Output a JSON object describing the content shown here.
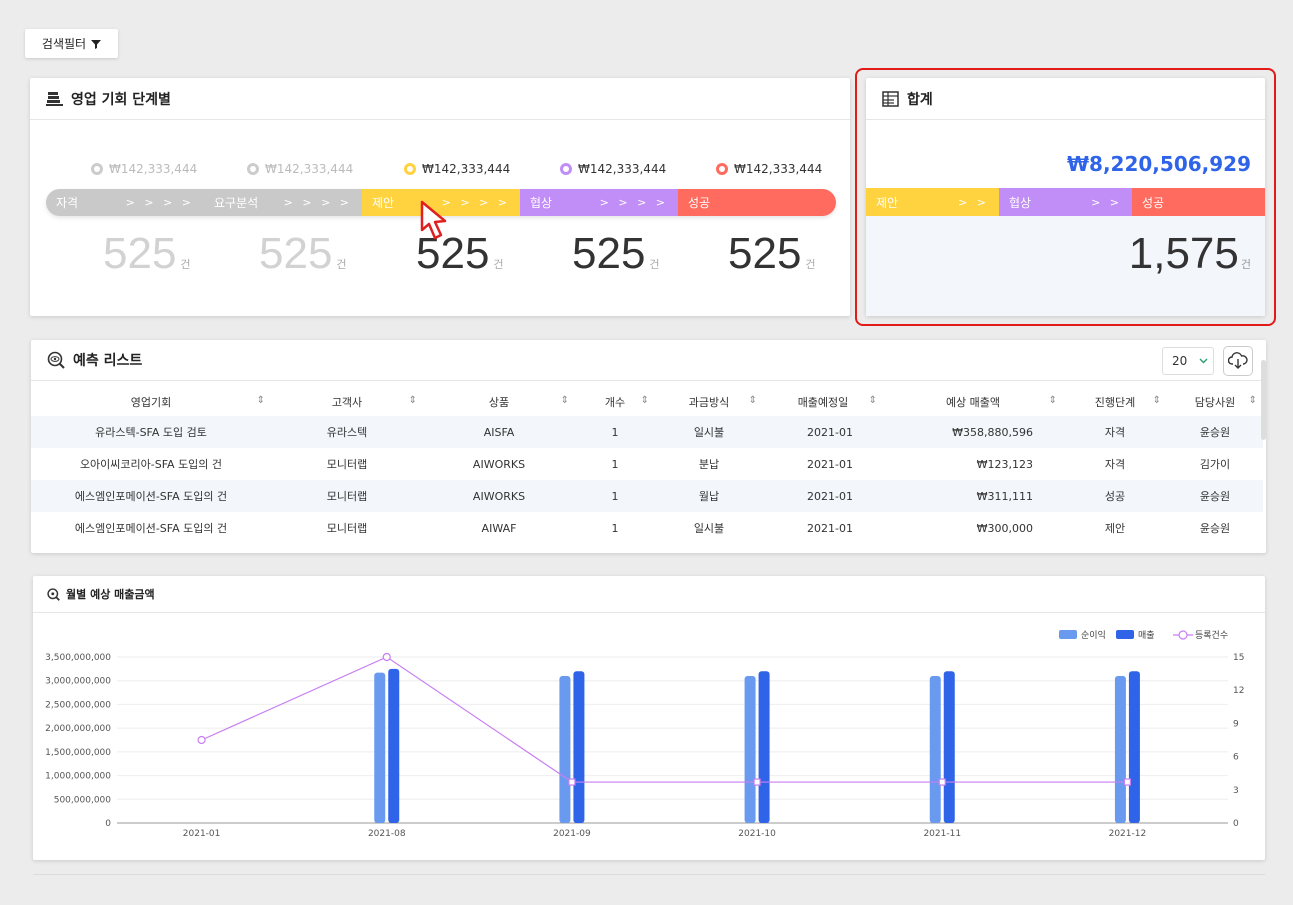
{
  "filter_button": {
    "label": "검색필터"
  },
  "stage_panel": {
    "title": "영업 기회 단계별",
    "stages": [
      {
        "label": "자격",
        "amount": "₩142,333,444",
        "count": "525",
        "unit": "건",
        "color": "#c9c9c9",
        "ring": "#cccccc",
        "active": false
      },
      {
        "label": "요구분석",
        "amount": "₩142,333,444",
        "count": "525",
        "unit": "건",
        "color": "#c9c9c9",
        "ring": "#cccccc",
        "active": false
      },
      {
        "label": "제안",
        "amount": "₩142,333,444",
        "count": "525",
        "unit": "건",
        "color": "#ffd23f",
        "ring": "#ffd23f",
        "active": true
      },
      {
        "label": "협상",
        "amount": "₩142,333,444",
        "count": "525",
        "unit": "건",
        "color": "#c08ef6",
        "ring": "#c08ef6",
        "active": true
      },
      {
        "label": "성공",
        "amount": "₩142,333,444",
        "count": "525",
        "unit": "건",
        "color": "#ff6b5e",
        "ring": "#ff6b5e",
        "active": true
      }
    ],
    "arrows": "> > > >"
  },
  "total_panel": {
    "title": "합계",
    "amount": "₩8,220,506,929",
    "count": "1,575",
    "unit": "건",
    "stages": [
      "제안",
      "협상",
      "성공"
    ],
    "arrows": "> >"
  },
  "forecast_list": {
    "title": "예측 리스트",
    "page_size": "20",
    "columns": [
      "영업기회",
      "고객사",
      "상품",
      "개수",
      "과금방식",
      "매출예정일",
      "예상 매출액",
      "진행단계",
      "담당사원"
    ],
    "rows": [
      [
        "유라스텍-SFA 도입 검토",
        "유라스텍",
        "AISFA",
        "1",
        "일시불",
        "2021-01",
        "₩358,880,596",
        "자격",
        "윤승원"
      ],
      [
        "오아이씨코리아-SFA 도입의 건",
        "모니터랩",
        "AIWORKS",
        "1",
        "분납",
        "2021-01",
        "₩123,123",
        "자격",
        "김가이"
      ],
      [
        "에스엠인포메이션-SFA 도입의 건",
        "모니터랩",
        "AIWORKS",
        "1",
        "월납",
        "2021-01",
        "₩311,111",
        "성공",
        "윤승원"
      ],
      [
        "에스엠인포메이션-SFA 도입의 건",
        "모니터랩",
        "AIWAF",
        "1",
        "일시불",
        "2021-01",
        "₩300,000",
        "제안",
        "윤승원"
      ]
    ]
  },
  "chart_panel": {
    "title": "월별 예상 매출금액"
  },
  "chart_data": {
    "type": "bar",
    "categories": [
      "2021-01",
      "2021-08",
      "2021-09",
      "2021-10",
      "2021-11",
      "2021-12"
    ],
    "series": [
      {
        "name": "순이익",
        "type": "bar",
        "axis": "left",
        "color": "#6a9af0",
        "values": [
          0,
          3170000000,
          3100000000,
          3100000000,
          3100000000,
          3100000000
        ]
      },
      {
        "name": "매출",
        "type": "bar",
        "axis": "left",
        "color": "#2f63e8",
        "values": [
          0,
          3250000000,
          3200000000,
          3200000000,
          3200000000,
          3200000000
        ]
      },
      {
        "name": "등록건수",
        "type": "line",
        "axis": "right",
        "color": "#c77ef2",
        "values": [
          7.5,
          15,
          3.7,
          3.7,
          3.7,
          3.7
        ]
      }
    ],
    "y_left": {
      "ylim": [
        0,
        3500000000
      ],
      "ticks": [
        "0",
        "500,000,000",
        "1,000,000,000",
        "1,500,000,000",
        "2,000,000,000",
        "2,500,000,000",
        "3,000,000,000",
        "3,500,000,000"
      ]
    },
    "y_right": {
      "ylim": [
        0,
        15
      ],
      "ticks": [
        "0",
        "3",
        "6",
        "9",
        "12",
        "15"
      ]
    },
    "grid": true,
    "legend_position": "top-right"
  }
}
